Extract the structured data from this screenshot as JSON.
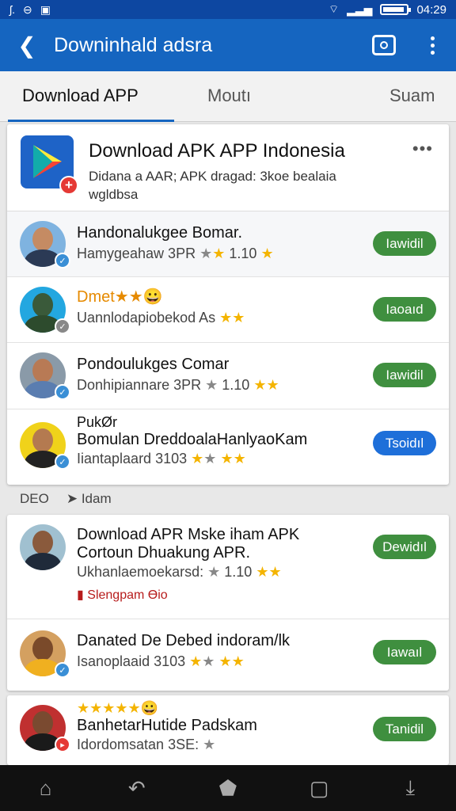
{
  "status": {
    "left_icons": [
      "signal-icon",
      "sync-icon",
      "notification-icon"
    ],
    "left_glyphs": [
      "ʃ.",
      "⊖",
      "▣"
    ],
    "time": "04:29"
  },
  "appbar": {
    "title": "Downinhald adsra"
  },
  "tabs": [
    {
      "label": "Download APP"
    },
    {
      "label": "Moutı"
    },
    {
      "label": "Suam"
    }
  ],
  "hero": {
    "title": "Download APK APP Indonesia",
    "desc": "Didana a AAR; APK dragad: 3koe bealaia wgldbsa",
    "more": "•••"
  },
  "rows": [
    {
      "title": "Handonalukgee Bomar.",
      "sub": "Hamygeahaw 3PR",
      "rating_text": "1.10",
      "stars": [
        0,
        1,
        1
      ],
      "button": "Iawidil",
      "button_color": "green"
    },
    {
      "title": "Dmet★★😀",
      "sub": "Uannlodapiobekod As",
      "rating_text": "",
      "stars": [
        1,
        1
      ],
      "button": "Iaoaıd",
      "button_color": "green"
    },
    {
      "title": "Pondoulukges Comar",
      "sub": "Donhipiannare 3PR",
      "rating_text": "1.10",
      "stars": [
        0,
        1,
        1
      ],
      "button": "Iawidil",
      "button_color": "green"
    },
    {
      "title": "PukØr",
      "title2": "Bomulan DreddoalaHanlyaoKam",
      "sub": "Iiantapla​ard 3103",
      "rating_text": "",
      "stars": [
        1,
        0,
        1,
        1
      ],
      "button": "Tsoidıl",
      "button_color": "blue"
    }
  ],
  "section": {
    "left": "DEO",
    "right": "Idam"
  },
  "rows2": [
    {
      "title": "Download APR Mske iham APK",
      "title2": "Cortoun Dhuakung APR.",
      "sub": "Ukhanlaemoekarsd:",
      "rating_text": "1.10",
      "stars": [
        0,
        1,
        1
      ],
      "tag": "Slengpam Ɵio",
      "button": "Dewidıl",
      "button_color": "green"
    },
    {
      "title": "Danated De Debed indoram/lk",
      "sub": "Isanoplaaid 3103",
      "rating_text": "",
      "stars": [
        1,
        0,
        1,
        1
      ],
      "button": "Iawaıl",
      "button_color": "green"
    }
  ],
  "rows3": [
    {
      "title": "★★★★★😀",
      "title2": "BanhetarHutide Padskam",
      "sub": "Idordomsatan 3SE:",
      "rating_text": "",
      "stars": [
        0
      ],
      "button": "Tanidil",
      "button_color": "green"
    }
  ],
  "navbar": {
    "icons": [
      "home-icon",
      "back-icon",
      "home-outline-icon",
      "recents-icon",
      "download-icon"
    ],
    "glyphs": [
      "⌂",
      "↶",
      "⬟",
      "▢",
      "⤓"
    ]
  }
}
